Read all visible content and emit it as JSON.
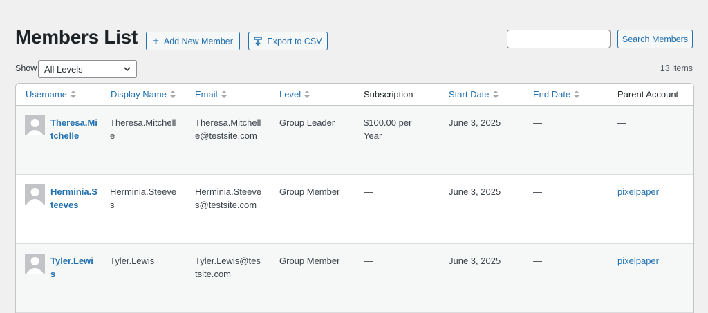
{
  "header": {
    "title": "Members List",
    "add_button": "Add New Member",
    "export_button": "Export to CSV",
    "search_placeholder": "",
    "search_button": "Search Members"
  },
  "filter": {
    "show_label": "Show",
    "level_selected": "All Levels",
    "items_count": "13 items"
  },
  "columns": {
    "username": "Username",
    "display_name": "Display Name",
    "email": "Email",
    "level": "Level",
    "subscription": "Subscription",
    "start_date": "Start Date",
    "end_date": "End Date",
    "parent_account": "Parent Account"
  },
  "rows": [
    {
      "username": "Theresa.Mitchelle",
      "display_name": "Theresa.Mitchelle",
      "email": "Theresa.Mitchelle@testsite.com",
      "level": "Group Leader",
      "subscription": "$100.00 per Year",
      "start_date": "June 3, 2025",
      "end_date": "—",
      "parent_account": "—"
    },
    {
      "username": "Herminia.Steeves",
      "display_name": "Herminia.Steeves",
      "email": "Herminia.Steeves@testsite.com",
      "level": "Group Member",
      "subscription": "—",
      "start_date": "June 3, 2025",
      "end_date": "—",
      "parent_account": "pixelpaper"
    },
    {
      "username": "Tyler.Lewis",
      "display_name": "Tyler.Lewis",
      "email": "Tyler.Lewis@testsite.com",
      "level": "Group Member",
      "subscription": "—",
      "start_date": "June 3, 2025",
      "end_date": "—",
      "parent_account": "pixelpaper"
    }
  ],
  "colors": {
    "accent": "#2271b1",
    "text": "#1d2327",
    "background": "#f0f0f1"
  }
}
